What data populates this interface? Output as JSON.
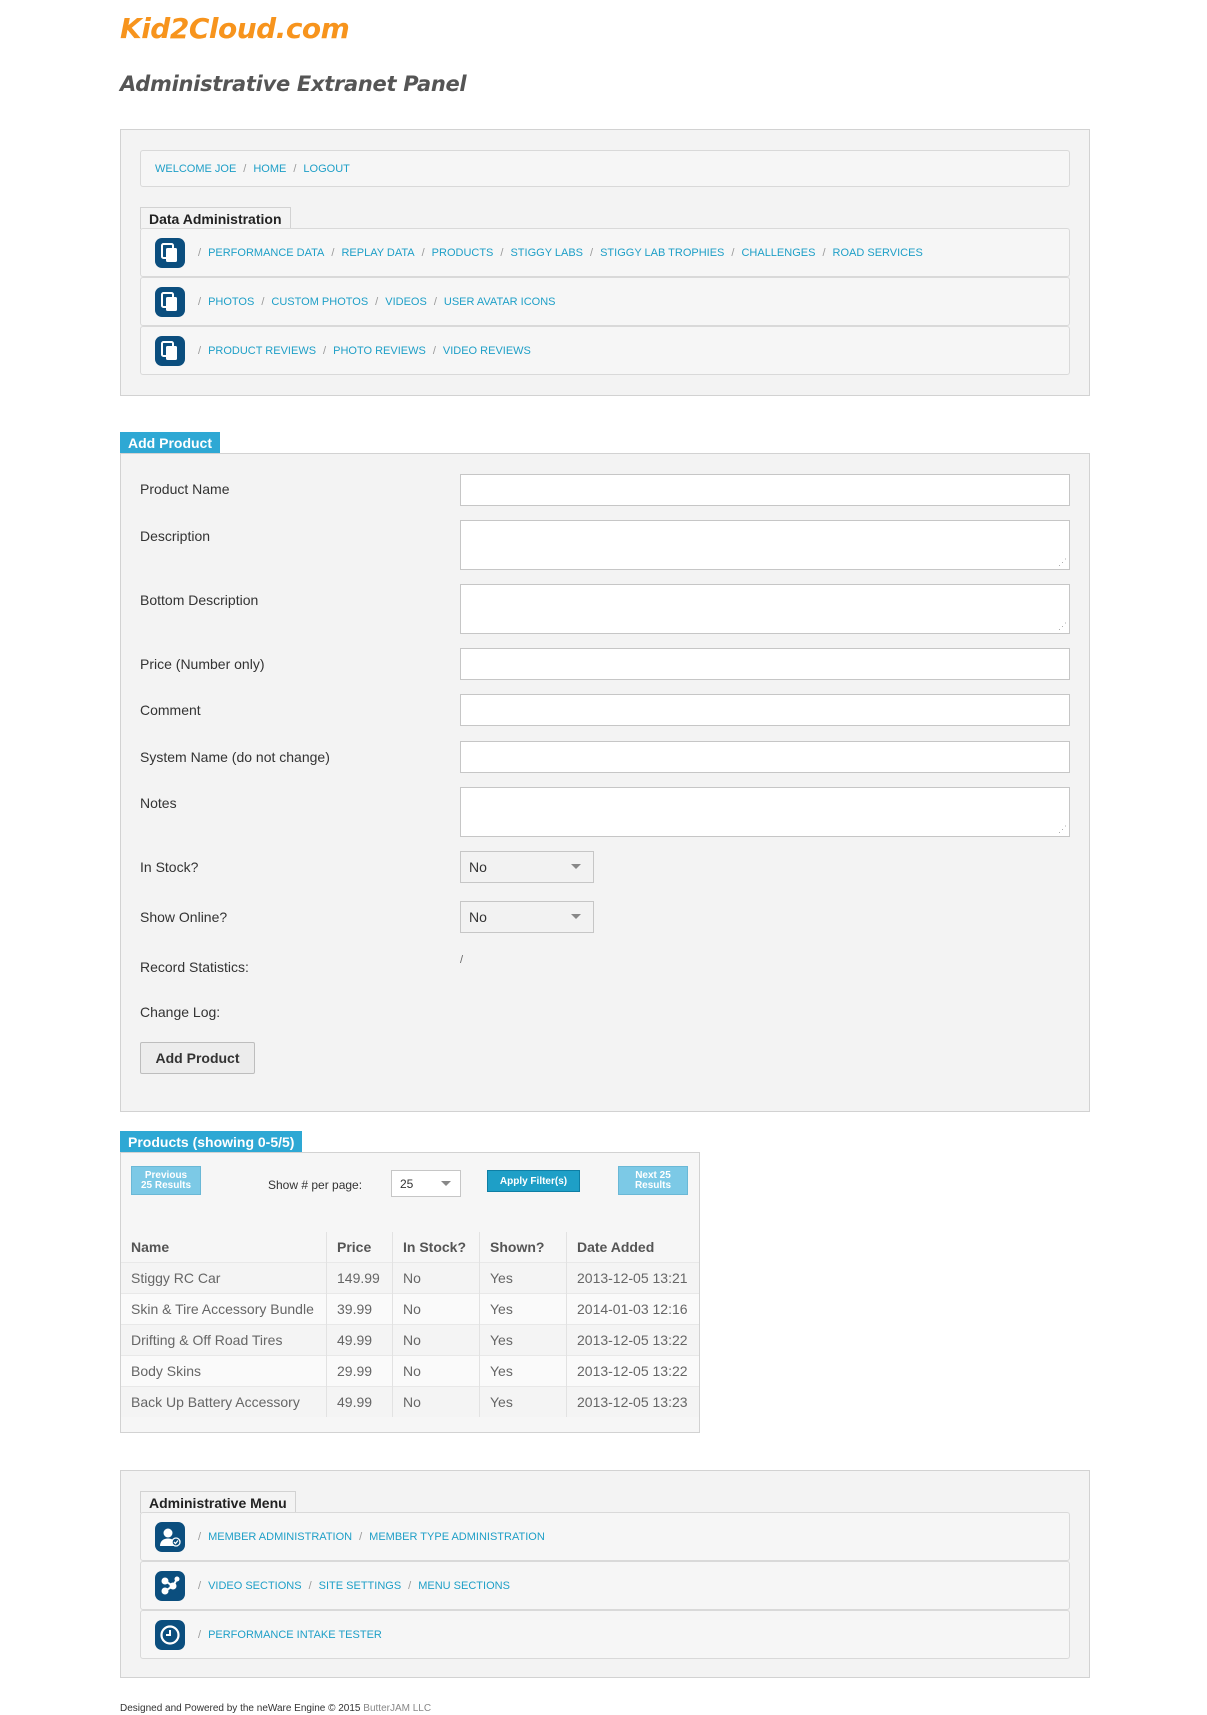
{
  "header": {
    "logo": "Kid2Cloud.com",
    "subtitle": "Administrative Extranet Panel"
  },
  "topnav": {
    "items": [
      "WELCOME JOE",
      "HOME",
      "LOGOUT"
    ]
  },
  "data_admin": {
    "title": "Data Administration",
    "rows": [
      {
        "icon": "copy-icon",
        "links": [
          "PERFORMANCE DATA",
          "REPLAY DATA",
          "PRODUCTS",
          "STIGGY LABS",
          "STIGGY LAB TROPHIES",
          "CHALLENGES",
          "ROAD SERVICES"
        ]
      },
      {
        "icon": "copy-icon",
        "links": [
          "PHOTOS",
          "CUSTOM PHOTOS",
          "VIDEOS",
          "USER AVATAR ICONS"
        ]
      },
      {
        "icon": "copy-icon",
        "links": [
          "PRODUCT REVIEWS",
          "PHOTO REVIEWS",
          "VIDEO REVIEWS"
        ]
      }
    ]
  },
  "add_product": {
    "title": "Add Product",
    "fields": {
      "product_name": "Product Name",
      "description": "Description",
      "bottom_description": "Bottom Description",
      "price": "Price (Number only)",
      "comment": "Comment",
      "system_name": "System Name (do not change)",
      "notes": "Notes",
      "in_stock": "In Stock?",
      "show_online": "Show Online?",
      "record_statistics": "Record Statistics:",
      "change_log": "Change Log:"
    },
    "in_stock_value": "No",
    "show_online_value": "No",
    "record_statistics_value": "/",
    "submit_label": "Add Product"
  },
  "products": {
    "title": "Products (showing 0-5/5)",
    "prev_label_1": "Previous",
    "prev_label_2": "25 Results",
    "per_page_label": "Show # per page:",
    "per_page_value": "25",
    "apply_label": "Apply Filter(s)",
    "next_label_1": "Next 25",
    "next_label_2": "Results",
    "columns": [
      "Name",
      "Price",
      "In Stock?",
      "Shown?",
      "Date Added"
    ],
    "rows": [
      [
        "Stiggy RC Car",
        "149.99",
        "No",
        "Yes",
        "2013-12-05 13:21"
      ],
      [
        "Skin & Tire Accessory Bundle",
        "39.99",
        "No",
        "Yes",
        "2014-01-03 12:16"
      ],
      [
        "Drifting & Off Road Tires",
        "49.99",
        "No",
        "Yes",
        "2013-12-05 13:22"
      ],
      [
        "Body Skins",
        "29.99",
        "No",
        "Yes",
        "2013-12-05 13:22"
      ],
      [
        "Back Up Battery Accessory",
        "49.99",
        "No",
        "Yes",
        "2013-12-05 13:23"
      ]
    ]
  },
  "admin_menu": {
    "title": "Administrative Menu",
    "rows": [
      {
        "icon": "user-check-icon",
        "links": [
          "MEMBER ADMINISTRATION",
          "MEMBER TYPE ADMINISTRATION"
        ]
      },
      {
        "icon": "network-icon",
        "links": [
          "VIDEO SECTIONS",
          "SITE SETTINGS",
          "MENU SECTIONS"
        ]
      },
      {
        "icon": "clock-icon",
        "links": [
          "PERFORMANCE INTAKE TESTER"
        ]
      }
    ]
  },
  "footer": {
    "text": "Designed and Powered by the neWare Engine © 2015",
    "company": "ButterJAM LLC"
  },
  "colors": {
    "brand": "#f7941d",
    "accent": "#1e9fc7",
    "icon_bg": "#0b4e7e"
  }
}
